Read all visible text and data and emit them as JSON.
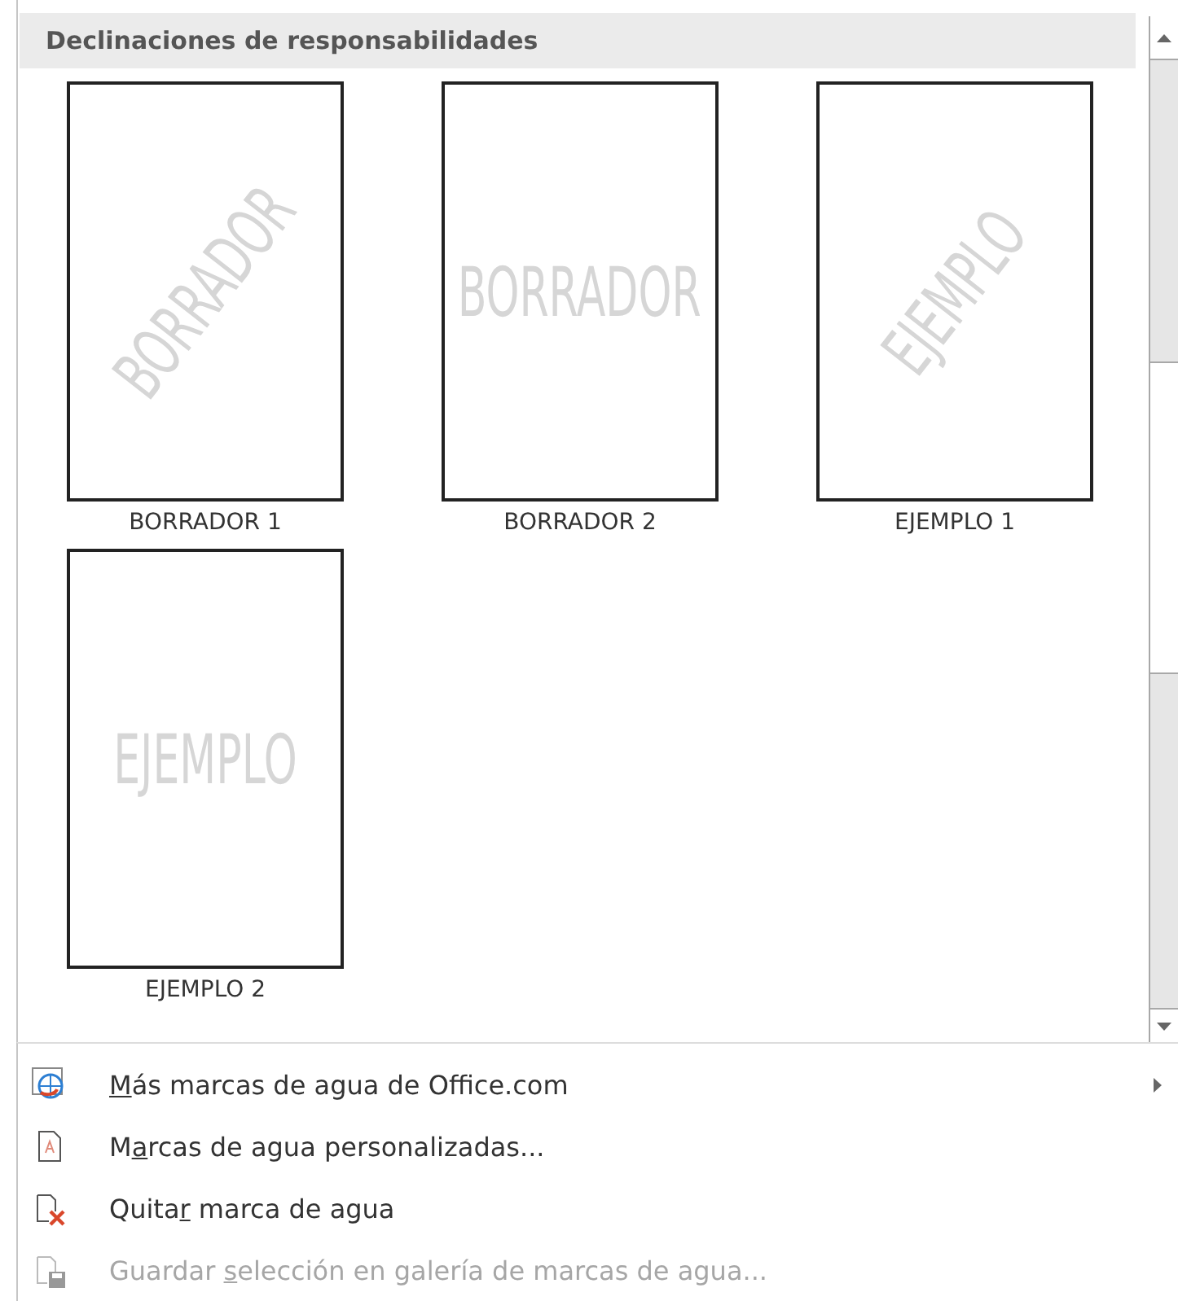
{
  "gallery": {
    "heading": "Declinaciones de responsabilidades",
    "items": [
      {
        "watermark": "BORRADOR",
        "kind": "diagonal",
        "label": "BORRADOR 1"
      },
      {
        "watermark": "BORRADOR",
        "kind": "horizontal",
        "label": "BORRADOR 2"
      },
      {
        "watermark": "EJEMPLO",
        "kind": "diagonal",
        "label": "EJEMPLO 1"
      },
      {
        "watermark": "EJEMPLO",
        "kind": "horizontal",
        "label": "EJEMPLO 2"
      }
    ]
  },
  "menu": [
    {
      "kind": "web",
      "accelerator": "M",
      "label_end": "ás marcas de agua de Office.com",
      "submenu": true,
      "disabled": false
    },
    {
      "kind": "custom",
      "label_start": "M",
      "accelerator": "a",
      "label_end": "rcas de agua personalizadas...",
      "submenu": false,
      "disabled": false
    },
    {
      "kind": "remove",
      "label_start": "Quita",
      "accelerator": "r",
      "label_end": " marca de agua",
      "submenu": false,
      "disabled": false
    },
    {
      "kind": "save",
      "label_start": "Guardar ",
      "accelerator": "s",
      "label_end": "elección en galería de marcas de agua...",
      "submenu": false,
      "disabled": true
    }
  ]
}
